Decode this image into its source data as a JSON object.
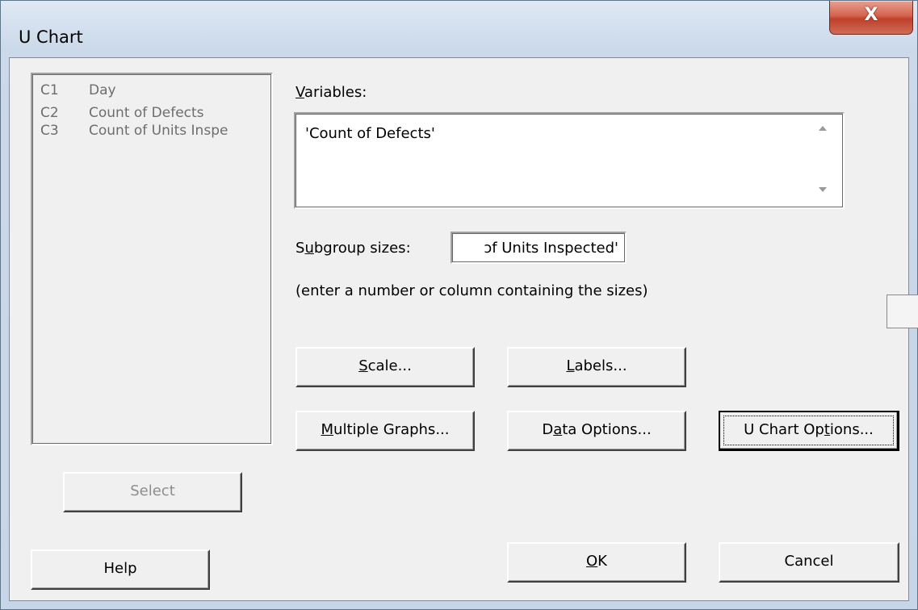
{
  "window": {
    "title": "U Chart",
    "close_glyph": "X"
  },
  "columns_list": [
    {
      "id": "C1",
      "name": "Day"
    },
    {
      "id": "C2",
      "name": "Count of Defects"
    },
    {
      "id": "C3",
      "name": "Count of Units Inspe"
    }
  ],
  "select_button": "Select",
  "variables": {
    "label_prefix": "V",
    "label_rest": "ariables:",
    "value": "'Count of Defects'"
  },
  "subgroup": {
    "label_pre": "S",
    "label_ul": "u",
    "label_post": "bgroup sizes:",
    "value": "ɔf Units Inspected'",
    "hint": "(enter a number or column containing the sizes)"
  },
  "buttons": {
    "scale": {
      "ul": "S",
      "rest": "cale..."
    },
    "labels": {
      "ul": "L",
      "rest": "abels..."
    },
    "multiple_graphs": {
      "ul": "M",
      "rest": "ultiple Graphs..."
    },
    "data_options": {
      "pre": "D",
      "ul": "a",
      "rest": "ta Options..."
    },
    "u_chart_options": {
      "pre": "U Chart Op",
      "ul": "t",
      "rest": "ions..."
    },
    "help": "Help",
    "ok": {
      "ul": "O",
      "rest": "K"
    },
    "cancel": "Cancel"
  },
  "icons": {
    "close": "close-icon",
    "scroll_up": "scroll-up-icon",
    "scroll_down": "scroll-down-icon"
  }
}
